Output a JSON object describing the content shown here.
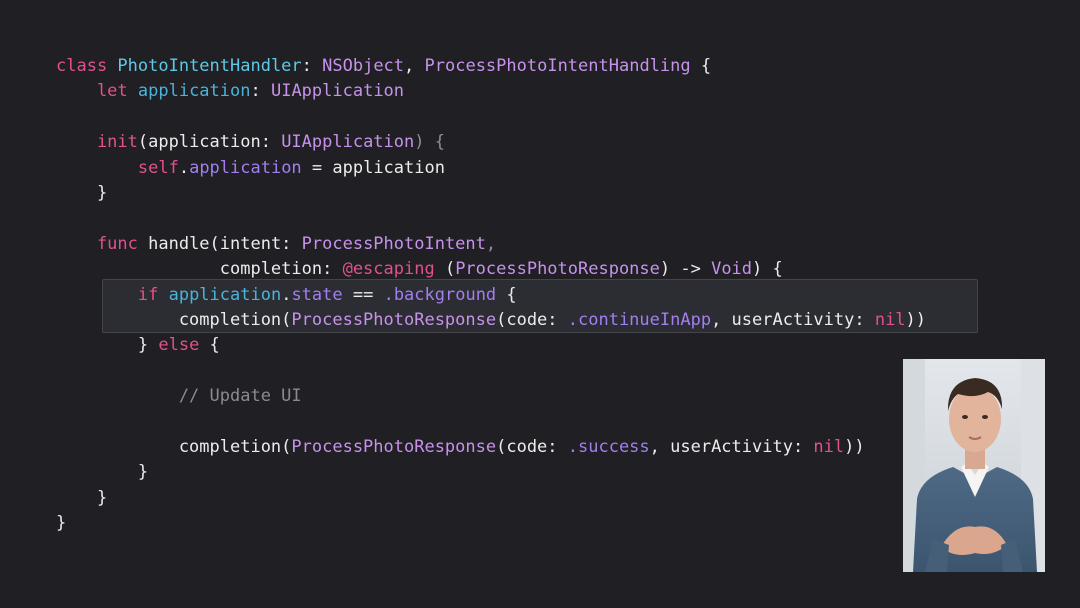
{
  "code_lines": [
    [
      {
        "t": "class ",
        "c": "kw"
      },
      {
        "t": "PhotoIntentHandler",
        "c": "cls"
      },
      {
        "t": ": ",
        "c": "pl"
      },
      {
        "t": "NSObject",
        "c": "ty"
      },
      {
        "t": ", ",
        "c": "pl"
      },
      {
        "t": "ProcessPhotoIntentHandling",
        "c": "ty"
      },
      {
        "t": " {",
        "c": "pl"
      }
    ],
    [
      {
        "t": "    let ",
        "c": "kw"
      },
      {
        "t": "application",
        "c": "prop"
      },
      {
        "t": ": ",
        "c": "pl"
      },
      {
        "t": "UIApplication",
        "c": "ty"
      }
    ],
    [],
    [
      {
        "t": "    init",
        "c": "kw"
      },
      {
        "t": "(application: ",
        "c": "pl"
      },
      {
        "t": "UIApplication",
        "c": "ty"
      },
      {
        "t": ") {",
        "c": "dim"
      }
    ],
    [
      {
        "t": "        self",
        "c": "kw"
      },
      {
        "t": ".",
        "c": "pl"
      },
      {
        "t": "application",
        "c": "mem"
      },
      {
        "t": " = application",
        "c": "pl"
      }
    ],
    [
      {
        "t": "    }",
        "c": "pl"
      }
    ],
    [],
    [
      {
        "t": "    func ",
        "c": "kw"
      },
      {
        "t": "handle(intent: ",
        "c": "pl"
      },
      {
        "t": "ProcessPhotoIntent",
        "c": "ty"
      },
      {
        "t": ",",
        "c": "dim"
      }
    ],
    [
      {
        "t": "                completion: ",
        "c": "pl"
      },
      {
        "t": "@escaping",
        "c": "kw"
      },
      {
        "t": " (",
        "c": "pl"
      },
      {
        "t": "ProcessPhotoResponse",
        "c": "ty"
      },
      {
        "t": ") -> ",
        "c": "pl"
      },
      {
        "t": "Void",
        "c": "ty"
      },
      {
        "t": ") {",
        "c": "pl"
      }
    ],
    [
      {
        "t": "        if ",
        "c": "kw"
      },
      {
        "t": "application",
        "c": "prop"
      },
      {
        "t": ".",
        "c": "pl"
      },
      {
        "t": "state",
        "c": "mem"
      },
      {
        "t": " == ",
        "c": "pl"
      },
      {
        "t": ".background",
        "c": "mem"
      },
      {
        "t": " {",
        "c": "pl"
      }
    ],
    [
      {
        "t": "            completion(",
        "c": "pl"
      },
      {
        "t": "ProcessPhotoResponse",
        "c": "ty"
      },
      {
        "t": "(code: ",
        "c": "pl"
      },
      {
        "t": ".continueInApp",
        "c": "mem"
      },
      {
        "t": ", userActivity: ",
        "c": "pl"
      },
      {
        "t": "nil",
        "c": "kw"
      },
      {
        "t": "))",
        "c": "pl"
      }
    ],
    [
      {
        "t": "        } ",
        "c": "pl"
      },
      {
        "t": "else",
        "c": "kw"
      },
      {
        "t": " {",
        "c": "pl"
      }
    ],
    [],
    [
      {
        "t": "            // Update UI",
        "c": "cm"
      }
    ],
    [],
    [
      {
        "t": "            completion(",
        "c": "pl"
      },
      {
        "t": "ProcessPhotoResponse",
        "c": "ty"
      },
      {
        "t": "(code: ",
        "c": "pl"
      },
      {
        "t": ".success",
        "c": "mem"
      },
      {
        "t": ", userActivity: ",
        "c": "pl"
      },
      {
        "t": "nil",
        "c": "kw"
      },
      {
        "t": "))",
        "c": "pl"
      }
    ],
    [
      {
        "t": "        }",
        "c": "pl"
      }
    ],
    [
      {
        "t": "    }",
        "c": "pl"
      }
    ],
    [
      {
        "t": "}",
        "c": "pl"
      }
    ]
  ],
  "highlighted_lines": [
    9,
    10
  ],
  "presenter_video": {
    "icon": "presenter-video-icon"
  }
}
